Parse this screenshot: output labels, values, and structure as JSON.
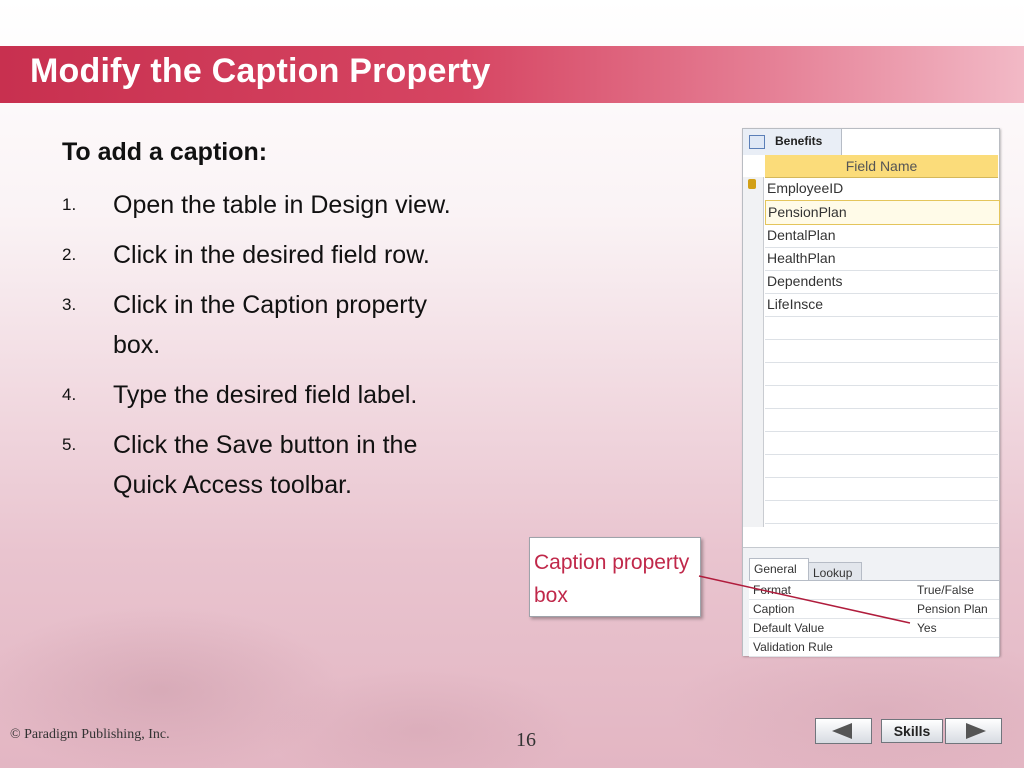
{
  "slide": {
    "title": "Modify the Caption Property",
    "lead": "To add a caption:",
    "steps": [
      {
        "num": "1.",
        "text": "Open the table in Design view."
      },
      {
        "num": "2.",
        "text": "Click in the desired field row."
      },
      {
        "num": "3.",
        "text": "Click in the Caption property box."
      },
      {
        "num": "4.",
        "text": "Type the desired field label."
      },
      {
        "num": "5.",
        "text": "Click the Save button in the Quick Access toolbar."
      }
    ],
    "callout": "Caption property box"
  },
  "access": {
    "tab_label": "Benefits",
    "column_header": "Field Name",
    "fields": [
      "EmployeeID",
      "PensionPlan",
      "DentalPlan",
      "HealthPlan",
      "Dependents",
      "LifeInsce"
    ],
    "panel_tabs": [
      "General",
      "Lookup"
    ],
    "properties": [
      {
        "name": "Format",
        "value": "True/False"
      },
      {
        "name": "Caption",
        "value": "Pension Plan"
      },
      {
        "name": "Default Value",
        "value": "Yes"
      },
      {
        "name": "Validation Rule",
        "value": ""
      }
    ]
  },
  "footer": {
    "copyright": "© Paradigm Publishing, Inc.",
    "page": "16",
    "skills_label": "Skills"
  },
  "colors": {
    "title_bar": "#c8304f",
    "callout_text": "#c0284a",
    "header_yellow": "#fbdc7a"
  }
}
